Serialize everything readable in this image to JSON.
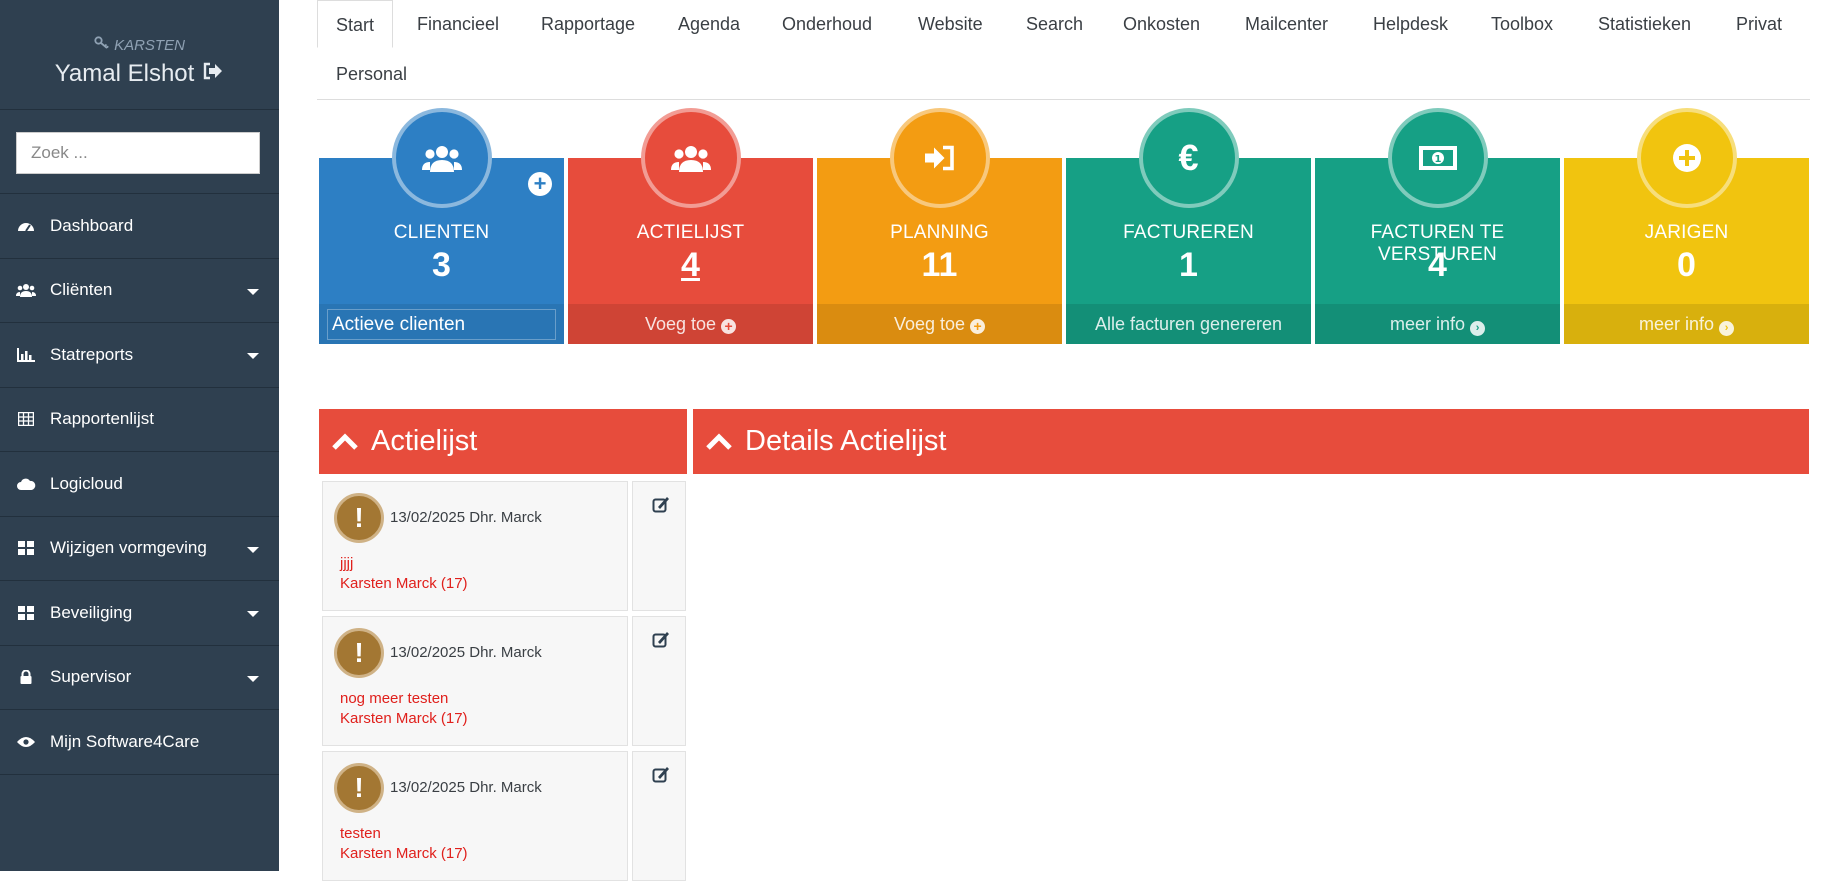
{
  "user": {
    "role": "KARSTEN",
    "name": "Yamal Elshot"
  },
  "search": {
    "placeholder": "Zoek ..."
  },
  "sidebar": {
    "items": [
      {
        "label": "Dashboard",
        "icon": "dashboard-icon",
        "has_submenu": false
      },
      {
        "label": "Cliënten",
        "icon": "users-icon",
        "has_submenu": true
      },
      {
        "label": "Statreports",
        "icon": "bar-chart-icon",
        "has_submenu": true
      },
      {
        "label": "Rapportenlijst",
        "icon": "table-icon",
        "has_submenu": false
      },
      {
        "label": "Logicloud",
        "icon": "cloud-icon",
        "has_submenu": false
      },
      {
        "label": "Wijzigen vormgeving",
        "icon": "grid-icon",
        "has_submenu": true
      },
      {
        "label": "Beveiliging",
        "icon": "grid-icon",
        "has_submenu": true
      },
      {
        "label": "Supervisor",
        "icon": "lock-icon",
        "has_submenu": true
      },
      {
        "label": "Mijn Software4Care",
        "icon": "eye-icon",
        "has_submenu": false
      }
    ]
  },
  "tabs": [
    "Start",
    "Financieel",
    "Rapportage",
    "Agenda",
    "Onderhoud",
    "Website",
    "Search",
    "Onkosten",
    "Mailcenter",
    "Helpdesk",
    "Toolbox",
    "Statistieken",
    "Privat",
    "Personal"
  ],
  "tiles": [
    {
      "label": "CLIENTEN",
      "value": "3",
      "footer": "Actieve clienten",
      "color": "#2d7fc4",
      "icon": "users-icon"
    },
    {
      "label": "ACTIELIJST",
      "value": "4",
      "footer": "Voeg toe",
      "color": "#e74c3c",
      "icon": "users-icon"
    },
    {
      "label": "PLANNING",
      "value": "11",
      "footer": "Voeg toe",
      "color": "#f39c12",
      "icon": "sign-in-icon"
    },
    {
      "label": "FACTUREREN",
      "value": "1",
      "footer": "Alle facturen genereren",
      "color": "#16a085",
      "icon": "euro-icon"
    },
    {
      "label": "FACTUREN TE VERSTUREN",
      "value": "4",
      "footer": "meer info",
      "color": "#16a085",
      "icon": "money-icon"
    },
    {
      "label": "JARIGEN",
      "value": "0",
      "footer": "meer info",
      "color": "#f1c40f",
      "icon": "plus-circle-icon"
    }
  ],
  "panels": {
    "actielijst_title": "Actielijst",
    "details_title": "Details Actielijst"
  },
  "actions": [
    {
      "date_person": "13/02/2025 Dhr. Marck",
      "text": "jjjj",
      "client": "Karsten Marck (17)"
    },
    {
      "date_person": "13/02/2025 Dhr. Marck",
      "text": "nog meer testen",
      "client": "Karsten Marck (17)"
    },
    {
      "date_person": "13/02/2025 Dhr. Marck",
      "text": "testen",
      "client": "Karsten Marck (17)"
    }
  ],
  "colors": {
    "sidebar": "#2f4050",
    "accent_red": "#e74c3c",
    "warning_badge": "#a37733"
  }
}
